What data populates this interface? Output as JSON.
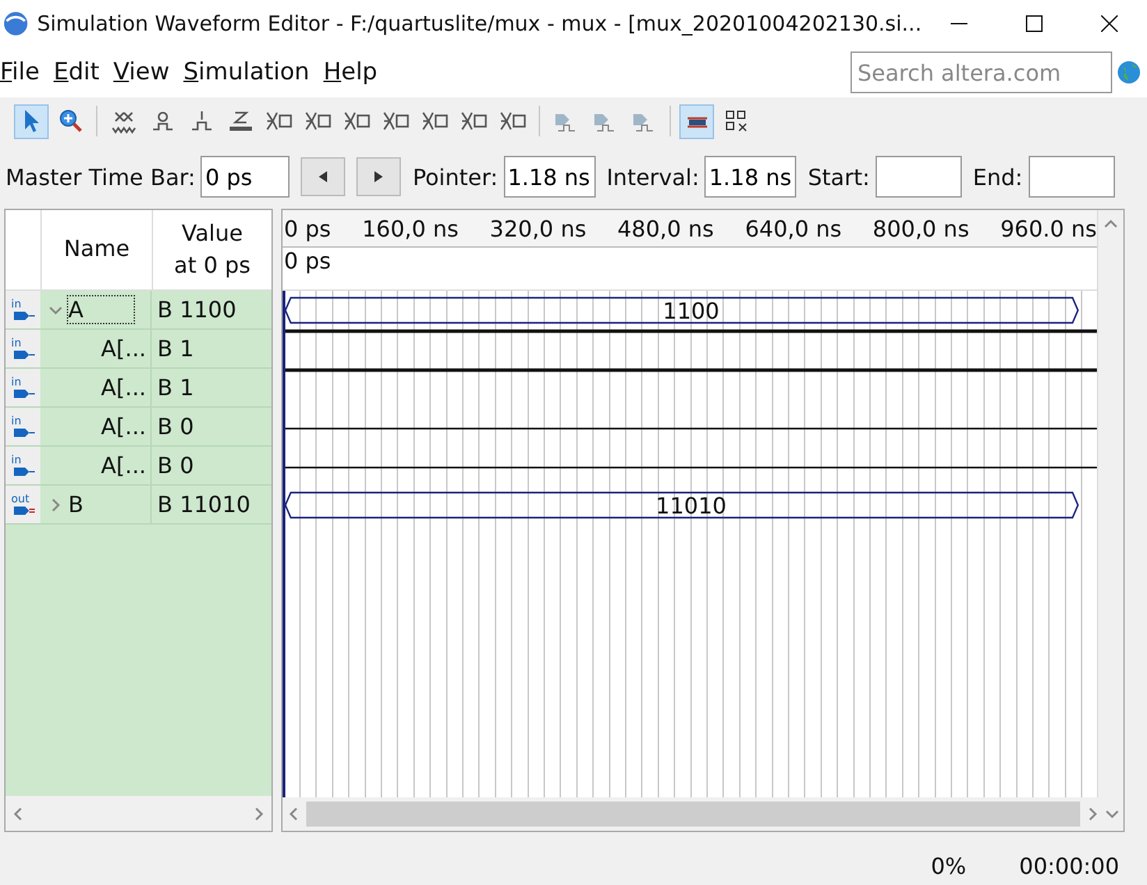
{
  "window": {
    "title": "Simulation Waveform Editor - F:/quartuslite/mux - mux - [mux_20201004202130.si..."
  },
  "menu": [
    {
      "label": "File"
    },
    {
      "label": "Edit"
    },
    {
      "label": "View"
    },
    {
      "label": "Simulation"
    },
    {
      "label": "Help"
    }
  ],
  "search": {
    "placeholder": "Search altera.com"
  },
  "toolbar": [
    {
      "kind": "select",
      "selected": true
    },
    {
      "kind": "zoom",
      "selected": false
    },
    {
      "kind": "sep"
    },
    {
      "kind": "unknown",
      "selected": false
    },
    {
      "kind": "low",
      "selected": false
    },
    {
      "kind": "high",
      "selected": false
    },
    {
      "kind": "z",
      "selected": false
    },
    {
      "kind": "wl",
      "selected": false
    },
    {
      "kind": "wh",
      "selected": false
    },
    {
      "kind": "inv",
      "selected": false
    },
    {
      "kind": "count",
      "selected": false
    },
    {
      "kind": "clock",
      "selected": false
    },
    {
      "kind": "arb",
      "selected": false
    },
    {
      "kind": "rand",
      "selected": false
    },
    {
      "kind": "sep"
    },
    {
      "kind": "func",
      "selected": false
    },
    {
      "kind": "timing",
      "selected": false
    },
    {
      "kind": "netlist",
      "selected": false
    },
    {
      "kind": "sep"
    },
    {
      "kind": "snap",
      "selected": true
    },
    {
      "kind": "grid",
      "selected": false
    }
  ],
  "time_bar": {
    "master_label": "Master Time Bar:",
    "master_value": "0 ps",
    "pointer_label": "Pointer:",
    "pointer_value": "1.18 ns",
    "interval_label": "Interval:",
    "interval_value": "1.18 ns",
    "start_label": "Start:",
    "end_label": "End:"
  },
  "columns": {
    "name": "Name",
    "value": "Value at 0 ps"
  },
  "ruler": {
    "ticks": [
      "0 ps",
      "160,0 ns",
      "320,0 ns",
      "480,0 ns",
      "640,0 ns",
      "800,0 ns",
      "960.0 ns"
    ],
    "cursor_label": "0 ps"
  },
  "signals": [
    {
      "direction": "in",
      "name": "A",
      "value": "B 1100",
      "expanded": true,
      "selected": true,
      "wave": {
        "kind": "bus",
        "label": "1100"
      },
      "children": [
        {
          "direction": "in",
          "name": "A[...",
          "value": "B 1",
          "wave": {
            "kind": "bit",
            "high": true
          }
        },
        {
          "direction": "in",
          "name": "A[...",
          "value": "B 1",
          "wave": {
            "kind": "bit",
            "high": true
          }
        },
        {
          "direction": "in",
          "name": "A[...",
          "value": "B 0",
          "wave": {
            "kind": "bit",
            "high": false
          }
        },
        {
          "direction": "in",
          "name": "A[...",
          "value": "B 0",
          "wave": {
            "kind": "bit",
            "high": false
          }
        }
      ]
    },
    {
      "direction": "out",
      "name": "B",
      "value": "B 11010",
      "expanded": false,
      "selected": false,
      "wave": {
        "kind": "bus",
        "label": "11010"
      }
    }
  ],
  "status_bar": {
    "progress": "0%",
    "elapsed": "00:00:00"
  }
}
